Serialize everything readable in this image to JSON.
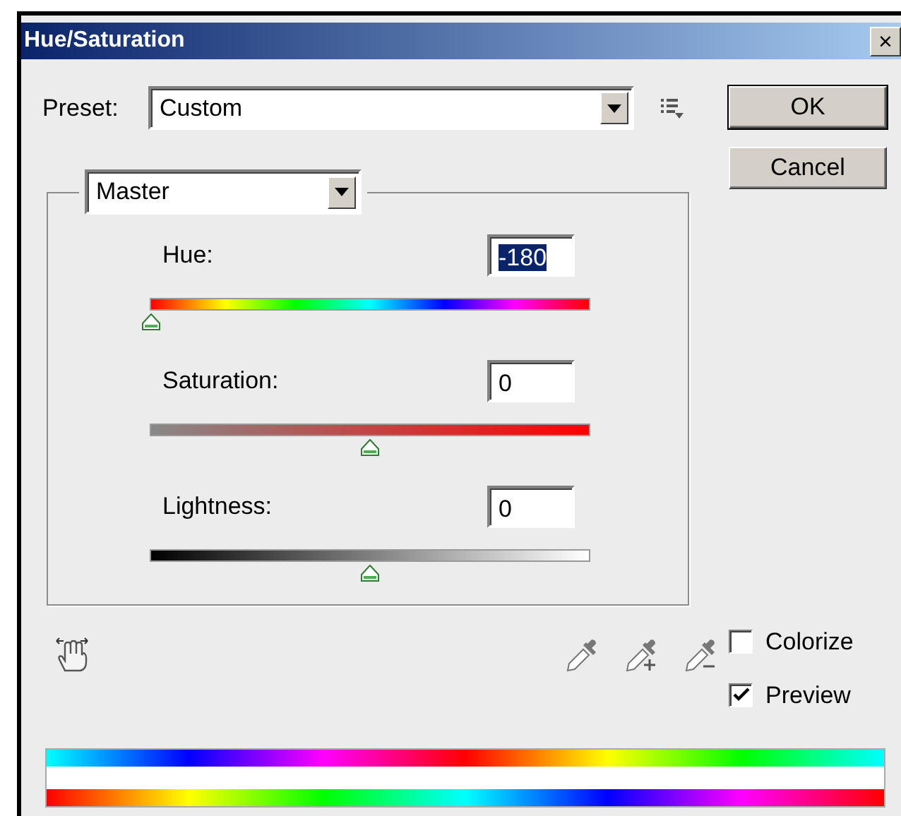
{
  "window": {
    "title": "Hue/Saturation",
    "close": "×"
  },
  "preset": {
    "label": "Preset:",
    "value": "Custom"
  },
  "buttons": [
    "OK",
    "Cancel"
  ],
  "channel": {
    "value": "Master"
  },
  "sliders": [
    {
      "kind": "hue",
      "label": "Hue:",
      "value": "-180",
      "highlighted": true,
      "level": 0
    },
    {
      "kind": "saturation",
      "label": "Saturation:",
      "value": "0",
      "highlighted": false,
      "level": 0.5
    },
    {
      "kind": "lightness",
      "label": "Lightness:",
      "value": "0",
      "highlighted": false,
      "level": 0.5
    }
  ],
  "options": [
    {
      "label": "Colorize",
      "checked": false
    },
    {
      "label": "Preview",
      "checked": true
    }
  ]
}
